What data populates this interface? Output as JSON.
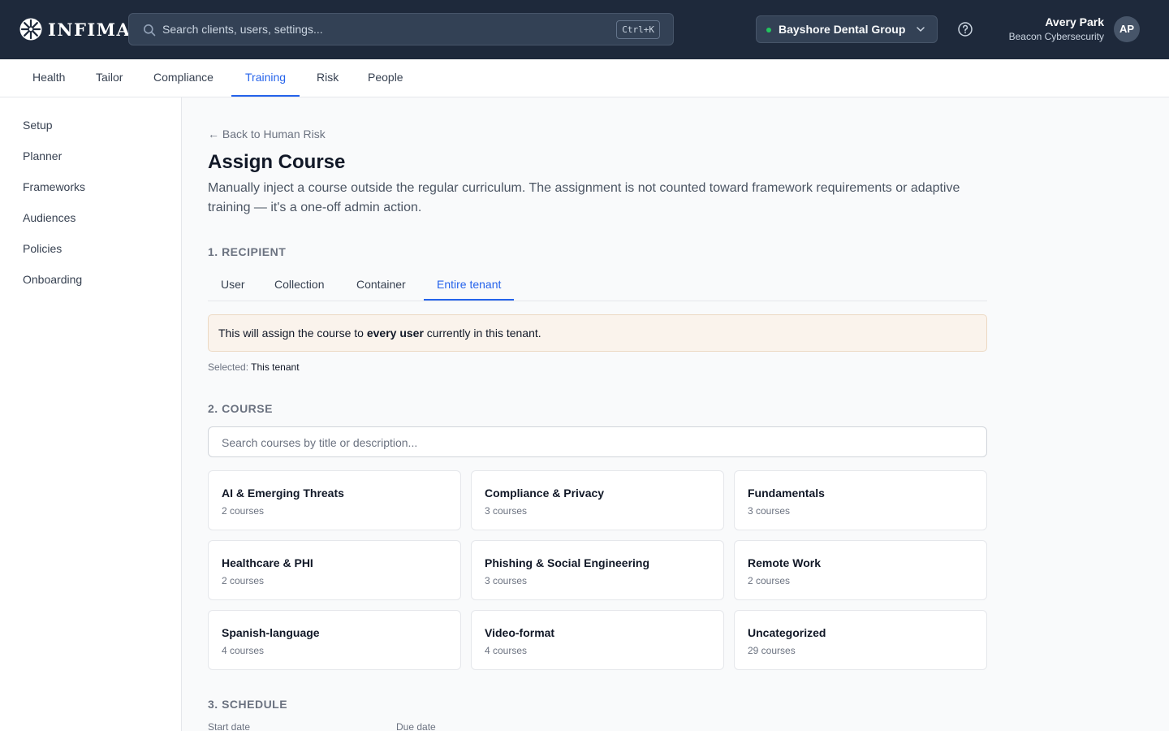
{
  "app": {
    "brand": "INFIMA"
  },
  "topbar": {
    "search_placeholder": "Search clients, users, settings...",
    "search_shortcut": "Ctrl+K",
    "tenant": "Bayshore Dental Group",
    "user_name": "Avery Park",
    "user_org": "Beacon Cybersecurity",
    "avatar_initials": "AP",
    "tenant_status_color": "#22c55e"
  },
  "primary_nav": [
    {
      "label": "Health"
    },
    {
      "label": "Tailor"
    },
    {
      "label": "Compliance"
    },
    {
      "label": "Training",
      "active": true
    },
    {
      "label": "Risk"
    },
    {
      "label": "People"
    }
  ],
  "sidebar": {
    "items": [
      {
        "label": "Setup"
      },
      {
        "label": "Planner"
      },
      {
        "label": "Frameworks"
      },
      {
        "label": "Audiences"
      },
      {
        "label": "Policies"
      },
      {
        "label": "Onboarding"
      }
    ]
  },
  "page": {
    "back_link": "Back to Human Risk",
    "title": "Assign Course",
    "description": "Manually inject a course outside the regular curriculum. The assignment is not counted toward framework requirements or adaptive training — it's a one-off admin action."
  },
  "recipient": {
    "section_label": "1. RECIPIENT",
    "tabs": [
      {
        "label": "User"
      },
      {
        "label": "Collection"
      },
      {
        "label": "Container"
      },
      {
        "label": "Entire tenant",
        "active": true
      }
    ],
    "notice_prefix": "This will assign the course to ",
    "notice_bold": "every user",
    "notice_suffix": " currently in this tenant.",
    "selected_label": "Selected: ",
    "selected_value": "This tenant"
  },
  "course": {
    "section_label": "2. COURSE",
    "search_placeholder": "Search courses by title or description...",
    "categories": [
      {
        "title": "AI & Emerging Threats",
        "count": "2 courses"
      },
      {
        "title": "Compliance & Privacy",
        "count": "3 courses"
      },
      {
        "title": "Fundamentals",
        "count": "3 courses"
      },
      {
        "title": "Healthcare & PHI",
        "count": "2 courses"
      },
      {
        "title": "Phishing & Social Engineering",
        "count": "3 courses"
      },
      {
        "title": "Remote Work",
        "count": "2 courses"
      },
      {
        "title": "Spanish-language",
        "count": "4 courses"
      },
      {
        "title": "Video-format",
        "count": "4 courses"
      },
      {
        "title": "Uncategorized",
        "count": "29 courses"
      }
    ]
  },
  "schedule": {
    "section_label": "3. SCHEDULE",
    "start_label": "Start date",
    "due_label": "Due date"
  },
  "colors": {
    "accent": "#2563eb",
    "topbar_bg": "#1e293b",
    "notice_bg": "#faf3ec"
  }
}
